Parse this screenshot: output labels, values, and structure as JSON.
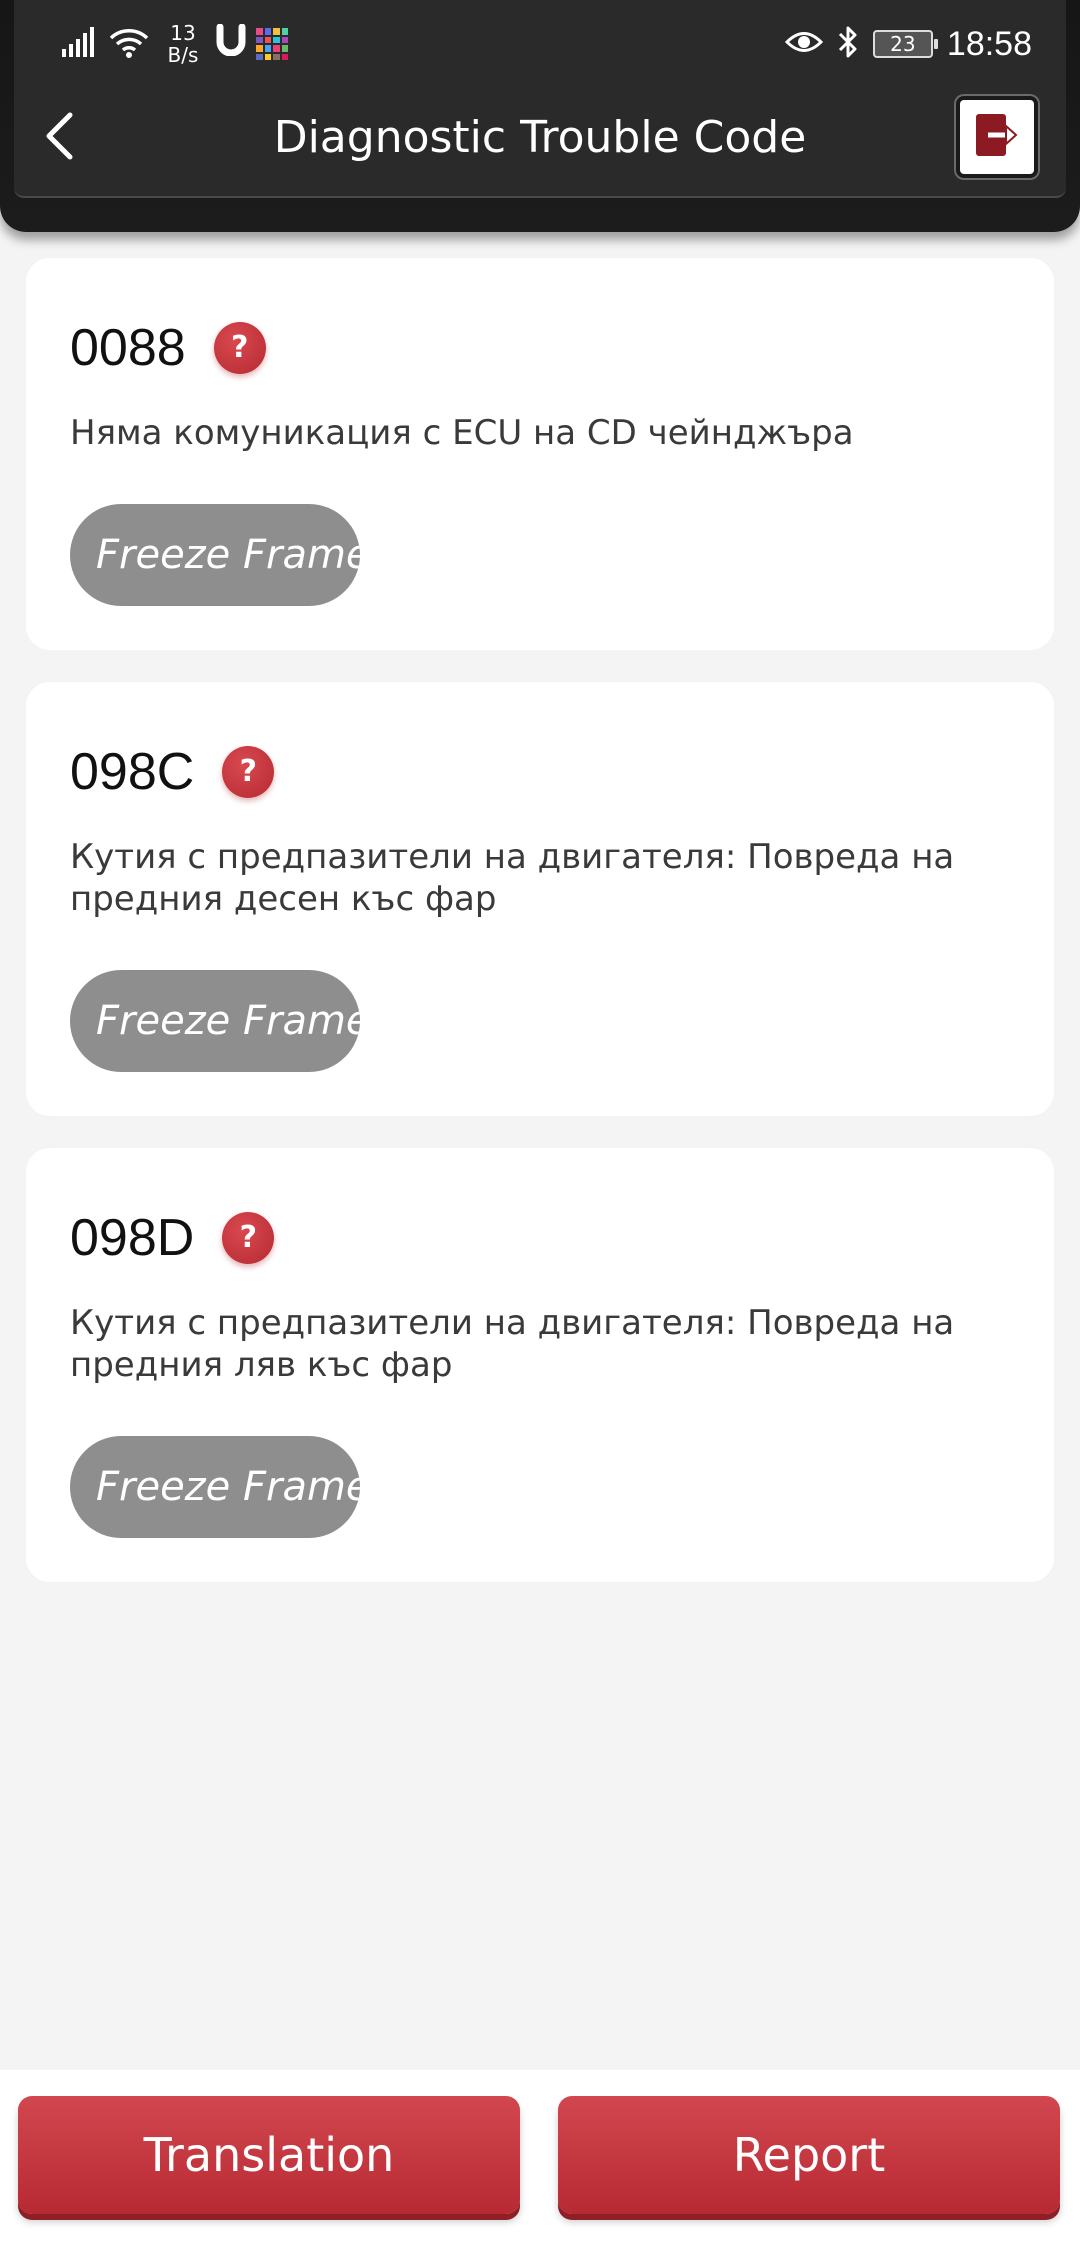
{
  "status_bar": {
    "net_speed_value": "13",
    "net_speed_unit": "B/s",
    "battery": "23",
    "time": "18:58"
  },
  "header": {
    "title": "Diagnostic Trouble Code"
  },
  "codes": [
    {
      "code": "0088",
      "help": "?",
      "description": "Няма комуникация с ECU на CD чейнджъра",
      "freeze_label": "Freeze Frame"
    },
    {
      "code": "098C",
      "help": "?",
      "description": "Кутия с предпазители на двигателя: Повреда на предния десен къс фар",
      "freeze_label": "Freeze Frame"
    },
    {
      "code": "098D",
      "help": "?",
      "description": "Кутия с предпазители на двигателя: Повреда на предния ляв къс фар",
      "freeze_label": "Freeze Frame"
    }
  ],
  "footer": {
    "translation_label": "Translation",
    "report_label": "Report"
  },
  "colors": {
    "accent": "#c0343c",
    "freeze_button": "#8e8e8e",
    "header": "#2a2a2a"
  }
}
